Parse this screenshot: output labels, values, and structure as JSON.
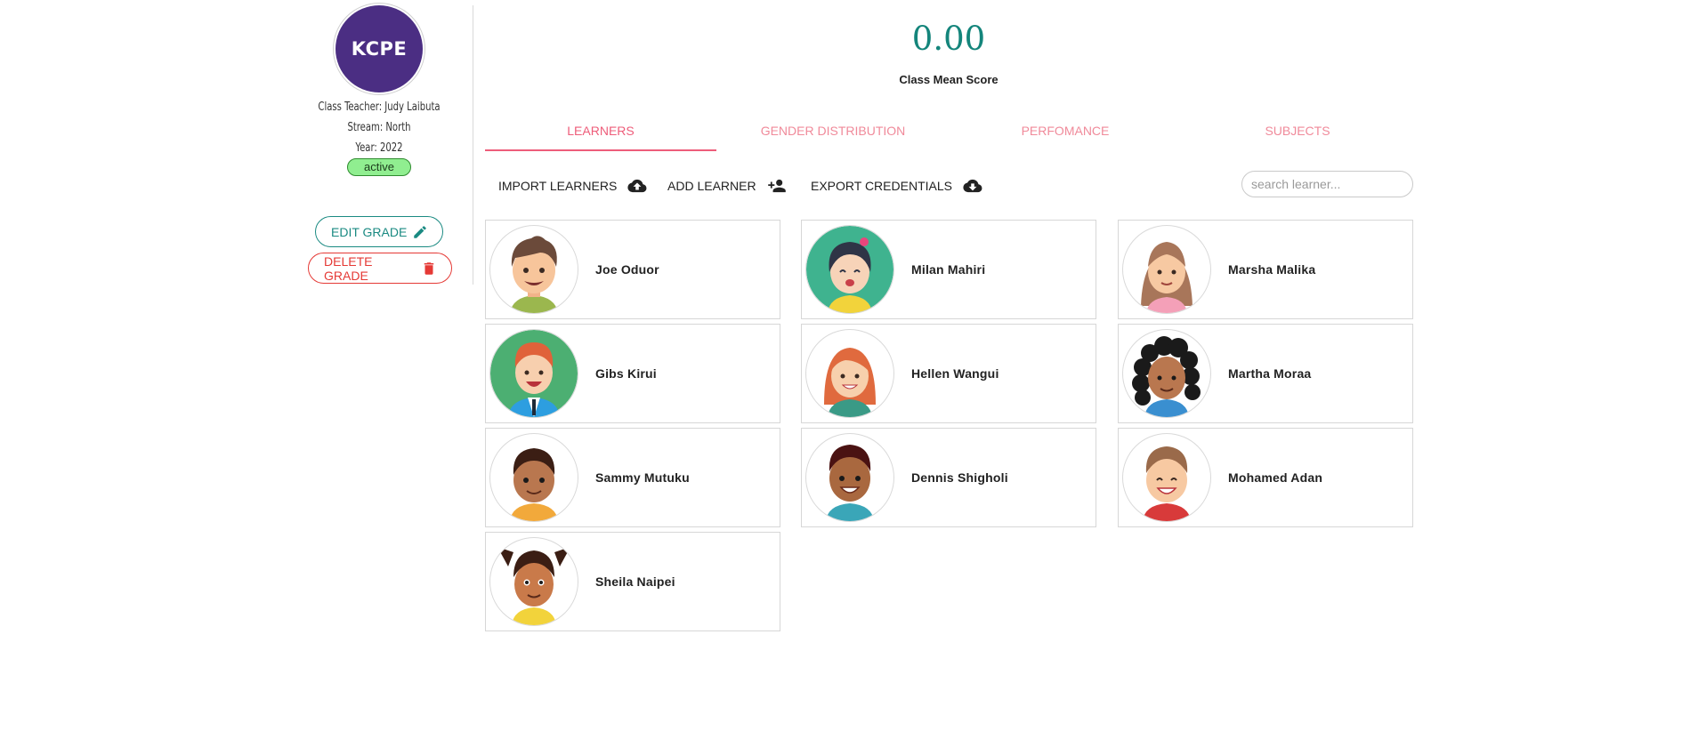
{
  "sidebar": {
    "logo_text": "KCPE",
    "class_teacher": "Class Teacher: Judy Laibuta",
    "stream": "Stream: North",
    "year": "Year: 2022",
    "status": "active",
    "edit_button": "EDIT GRADE",
    "delete_button": "DELETE GRADE"
  },
  "score": {
    "value": "0.00",
    "label": "Class Mean Score"
  },
  "tabs": [
    {
      "label": "LEARNERS",
      "active": true
    },
    {
      "label": "GENDER DISTRIBUTION",
      "active": false
    },
    {
      "label": "PERFOMANCE",
      "active": false
    },
    {
      "label": "SUBJECTS",
      "active": false
    }
  ],
  "toolbar": {
    "import_label": "IMPORT LEARNERS",
    "add_label": "ADD LEARNER",
    "export_label": "EXPORT CREDENTIALS",
    "search_placeholder": "search learner..."
  },
  "learners": [
    {
      "name": "Joe Oduor",
      "avatar": "boy-brown-hair-avatar"
    },
    {
      "name": "Milan Mahiri",
      "avatar": "girl-dark-hair-avatar"
    },
    {
      "name": "Marsha Malika",
      "avatar": "girl-brown-hair-avatar"
    },
    {
      "name": "Gibs Kirui",
      "avatar": "boy-red-hair-tie-avatar"
    },
    {
      "name": "Hellen Wangui",
      "avatar": "girl-red-hair-avatar"
    },
    {
      "name": "Martha Moraa",
      "avatar": "girl-curly-hair-avatar"
    },
    {
      "name": "Sammy Mutuku",
      "avatar": "boy-dark-hair-avatar"
    },
    {
      "name": "Dennis Shigholi",
      "avatar": "boy-dark-skin-avatar"
    },
    {
      "name": "Mohamed Adan",
      "avatar": "boy-smiling-avatar"
    },
    {
      "name": "Sheila Naipei",
      "avatar": "girl-pigtails-avatar"
    }
  ],
  "colors": {
    "logo": "#4b2e83",
    "accent_teal": "#14857b",
    "tab_pink": "#ee5d7a",
    "delete_red": "#e53935",
    "status_green": "#90ee90"
  }
}
